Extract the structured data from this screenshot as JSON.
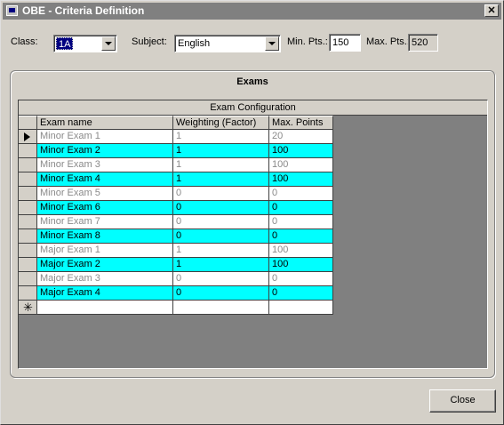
{
  "window": {
    "title": "OBE - Criteria Definition",
    "close_glyph": "✕"
  },
  "filters": {
    "class_label": "Class:",
    "class_value": "1A",
    "subject_label": "Subject:",
    "subject_value": "English",
    "min_label": "Min. Pts.:",
    "min_value": "150",
    "max_label": "Max. Pts.:",
    "max_value": "520"
  },
  "panel": {
    "title": "Exams"
  },
  "grid": {
    "caption": "Exam Configuration",
    "columns": [
      "Exam name",
      "Weighting (Factor)",
      "Max. Points"
    ],
    "rows": [
      {
        "name": "Minor Exam 1",
        "weighting": "1",
        "max_points": "20",
        "highlight": false,
        "current": true
      },
      {
        "name": "Minor Exam 2",
        "weighting": "1",
        "max_points": "100",
        "highlight": true,
        "current": false
      },
      {
        "name": "Minor Exam 3",
        "weighting": "1",
        "max_points": "100",
        "highlight": false,
        "current": false
      },
      {
        "name": "Minor Exam 4",
        "weighting": "1",
        "max_points": "100",
        "highlight": true,
        "current": false
      },
      {
        "name": "Minor Exam 5",
        "weighting": "0",
        "max_points": "0",
        "highlight": false,
        "current": false
      },
      {
        "name": "Minor Exam 6",
        "weighting": "0",
        "max_points": "0",
        "highlight": true,
        "current": false
      },
      {
        "name": "Minor Exam 7",
        "weighting": "0",
        "max_points": "0",
        "highlight": false,
        "current": false
      },
      {
        "name": "Minor Exam 8",
        "weighting": "0",
        "max_points": "0",
        "highlight": true,
        "current": false
      },
      {
        "name": "Major Exam 1",
        "weighting": "1",
        "max_points": "100",
        "highlight": false,
        "current": false
      },
      {
        "name": "Major Exam 2",
        "weighting": "1",
        "max_points": "100",
        "highlight": true,
        "current": false
      },
      {
        "name": "Major Exam 3",
        "weighting": "0",
        "max_points": "0",
        "highlight": false,
        "current": false
      },
      {
        "name": "Major Exam 4",
        "weighting": "0",
        "max_points": "0",
        "highlight": true,
        "current": false
      }
    ],
    "new_row_glyph": "✳",
    "highlight_color": "#00ffff"
  },
  "buttons": {
    "close_label": "Close"
  },
  "icons": {
    "app": "app-window-icon",
    "current_row": "record-pointer-icon",
    "new_row": "new-record-icon",
    "dropdown": "chevron-down-icon"
  }
}
